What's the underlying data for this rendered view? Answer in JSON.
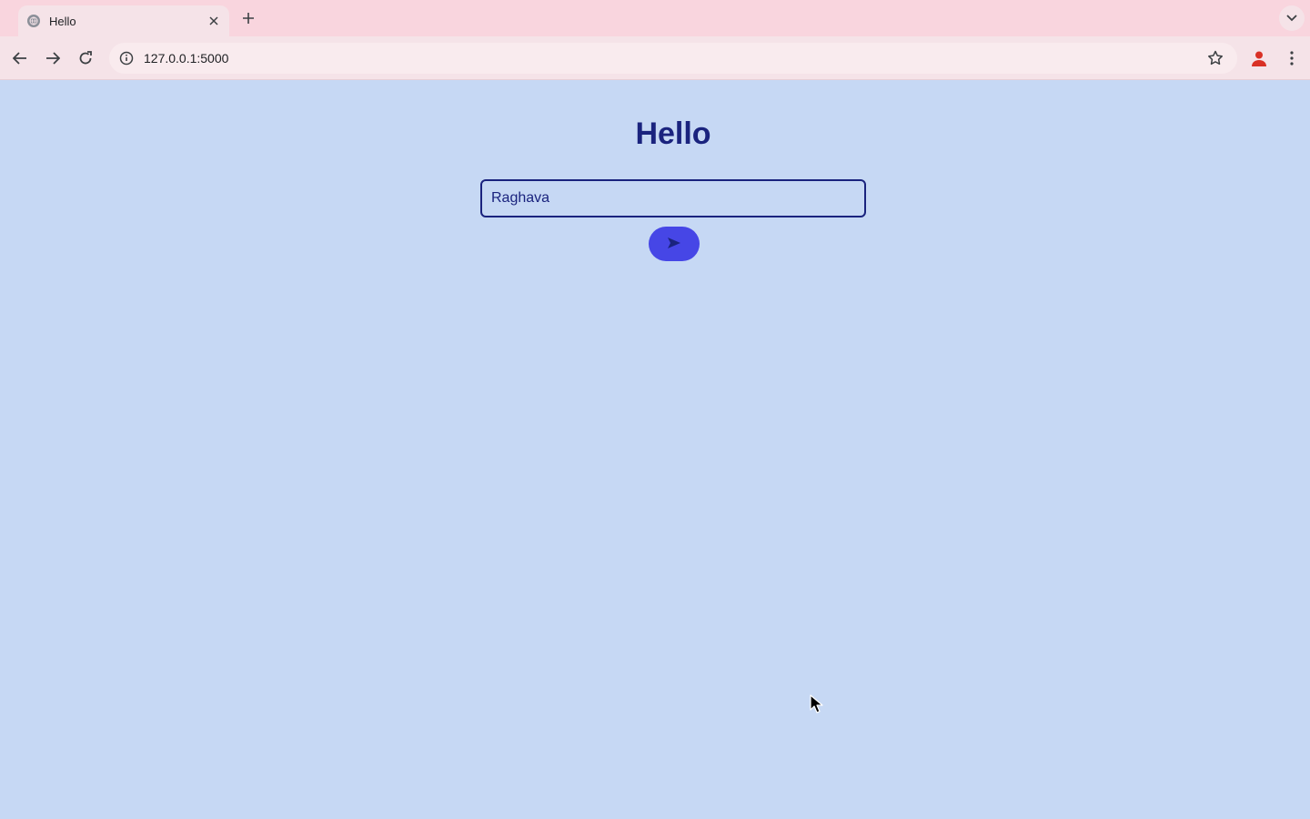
{
  "browser": {
    "tab_title": "Hello",
    "url": "127.0.0.1:5000",
    "icons": {
      "favicon": "globe-icon",
      "tab_close": "close-icon",
      "new_tab": "plus-icon",
      "tab_search": "chevron-down-icon",
      "back": "arrow-left-icon",
      "forward": "arrow-right-icon",
      "reload": "reload-icon",
      "site_info": "info-icon",
      "bookmark": "star-icon",
      "profile": "person-icon",
      "menu": "kebab-menu-icon"
    }
  },
  "page": {
    "heading": "Hello",
    "name_input": {
      "value": "Raghava"
    },
    "send_button": {
      "icon": "send-icon"
    },
    "colors": {
      "background": "#c6d8f4",
      "heading": "#1a237e",
      "button": "#4646e6"
    }
  }
}
